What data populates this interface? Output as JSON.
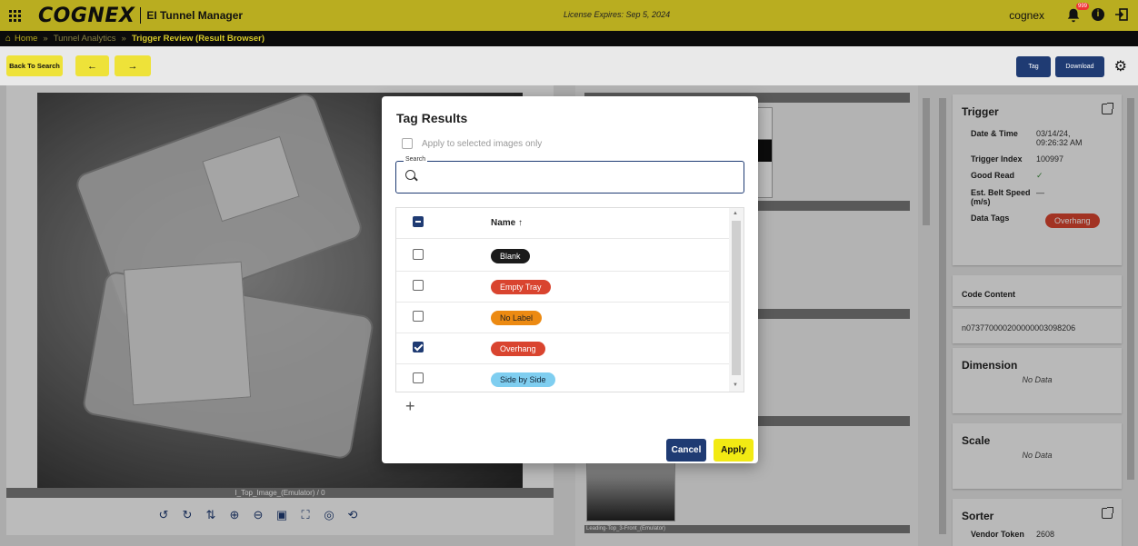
{
  "header": {
    "logo_text": "COGNEX",
    "app_title": "EI Tunnel Manager",
    "license": "License Expires: Sep 5, 2024",
    "user": "cognex",
    "notification_count": "999"
  },
  "breadcrumb": [
    "Home",
    "Tunnel Analytics",
    "Trigger Review (Result Browser)"
  ],
  "toolbar": {
    "back_label": "Back To Search",
    "prev_label": "←",
    "next_label": "→",
    "tag_label": "Tag",
    "download_label": "Download"
  },
  "image_panel": {
    "caption": "I_Top_Image_(Emulator) / 0",
    "tools": [
      "rotate-left",
      "rotate-right",
      "flip",
      "zoom-in",
      "zoom-out",
      "fit",
      "fullscreen",
      "focus",
      "reset"
    ]
  },
  "mid_panel": {
    "caption": "Leading-Top_3-Front_(Emulator)"
  },
  "trigger": {
    "title": "Trigger",
    "date_label": "Date & Time",
    "date_value": "03/14/24, 09:26:32 AM",
    "index_label": "Trigger Index",
    "index_value": "100997",
    "goodread_label": "Good Read",
    "goodread_value": "✓",
    "speed_label": "Est. Belt Speed (m/s)",
    "speed_value": "—",
    "tags_label": "Data Tags",
    "tag_value": "Overhang"
  },
  "code_content": {
    "title": "Code Content",
    "value": "n073770000200000003098206"
  },
  "dimension": {
    "title": "Dimension",
    "value": "No Data"
  },
  "scale": {
    "title": "Scale",
    "value": "No Data"
  },
  "sorter": {
    "title": "Sorter",
    "vendor_label": "Vendor Token",
    "vendor_value": "2608"
  },
  "modal": {
    "title": "Tag Results",
    "apply_selected": "Apply to selected images only",
    "search_legend": "Search",
    "search_value": "",
    "name_header": "Name ↑",
    "cancel": "Cancel",
    "apply": "Apply",
    "add": "+",
    "tags": [
      {
        "label": "Blank",
        "color": "#1b1b1b",
        "checked": false
      },
      {
        "label": "Empty Tray",
        "color": "#d9442f",
        "checked": false
      },
      {
        "label": "No Label",
        "color": "#ec8a12",
        "checked": false
      },
      {
        "label": "Overhang",
        "color": "#d9442f",
        "checked": true
      },
      {
        "label": "Side by Side",
        "color": "#7fcef0",
        "checked": false
      }
    ]
  },
  "colors": {
    "brand_yellow": "#b9ad20",
    "navy": "#1f3b73",
    "apply_yellow": "#f2ea13"
  }
}
